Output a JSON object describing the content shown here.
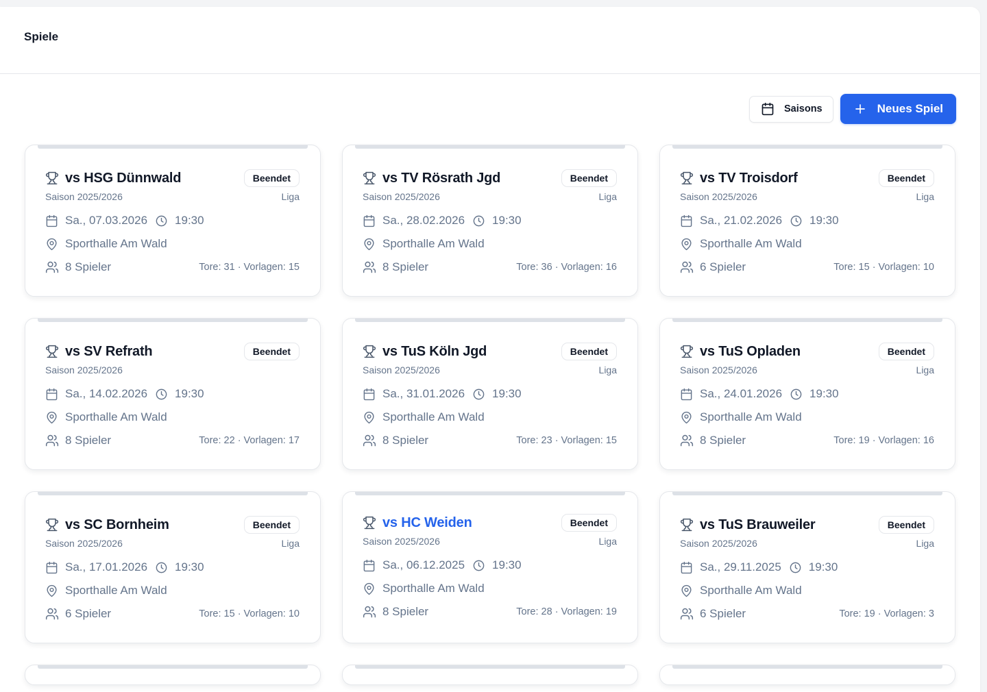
{
  "page": {
    "title": "Spiele"
  },
  "toolbar": {
    "seasons_label": "Saisons",
    "new_game_label": "Neues Spiel"
  },
  "colors": {
    "primary": "#2563eb",
    "muted": "#64748b",
    "text": "#111827"
  },
  "games": [
    {
      "opponent": "vs HSG Dünnwald",
      "status": "Beendet",
      "season": "Saison 2025/2026",
      "type": "Liga",
      "date": "Sa., 07.03.2026",
      "time": "19:30",
      "location": "Sporthalle Am Wald",
      "players": "8 Spieler",
      "stats": "Tore: 31 · Vorlagen: 15"
    },
    {
      "opponent": "vs TV Rösrath Jgd",
      "status": "Beendet",
      "season": "Saison 2025/2026",
      "type": "Liga",
      "date": "Sa., 28.02.2026",
      "time": "19:30",
      "location": "Sporthalle Am Wald",
      "players": "8 Spieler",
      "stats": "Tore: 36 · Vorlagen: 16"
    },
    {
      "opponent": "vs TV Troisdorf",
      "status": "Beendet",
      "season": "Saison 2025/2026",
      "type": "Liga",
      "date": "Sa., 21.02.2026",
      "time": "19:30",
      "location": "Sporthalle Am Wald",
      "players": "6 Spieler",
      "stats": "Tore: 15 · Vorlagen: 10"
    },
    {
      "opponent": "vs SV Refrath",
      "status": "Beendet",
      "season": "Saison 2025/2026",
      "type": "",
      "date": "Sa., 14.02.2026",
      "time": "19:30",
      "location": "Sporthalle Am Wald",
      "players": "8 Spieler",
      "stats": "Tore: 22 · Vorlagen: 17"
    },
    {
      "opponent": "vs TuS Köln Jgd",
      "status": "Beendet",
      "season": "Saison 2025/2026",
      "type": "Liga",
      "date": "Sa., 31.01.2026",
      "time": "19:30",
      "location": "Sporthalle Am Wald",
      "players": "8 Spieler",
      "stats": "Tore: 23 · Vorlagen: 15"
    },
    {
      "opponent": "vs TuS Opladen",
      "status": "Beendet",
      "season": "Saison 2025/2026",
      "type": "Liga",
      "date": "Sa., 24.01.2026",
      "time": "19:30",
      "location": "Sporthalle Am Wald",
      "players": "8 Spieler",
      "stats": "Tore: 19 · Vorlagen: 16"
    },
    {
      "opponent": "vs SC Bornheim",
      "status": "Beendet",
      "season": "Saison 2025/2026",
      "type": "Liga",
      "date": "Sa., 17.01.2026",
      "time": "19:30",
      "location": "Sporthalle Am Wald",
      "players": "6 Spieler",
      "stats": "Tore: 15 · Vorlagen: 10"
    },
    {
      "opponent": "vs HC Weiden",
      "status": "Beendet",
      "season": "Saison 2025/2026",
      "type": "Liga",
      "date": "Sa., 06.12.2025",
      "time": "19:30",
      "location": "Sporthalle Am Wald",
      "players": "8 Spieler",
      "stats": "Tore: 28 · Vorlagen: 19"
    },
    {
      "opponent": "vs TuS Brauweiler",
      "status": "Beendet",
      "season": "Saison 2025/2026",
      "type": "Liga",
      "date": "Sa., 29.11.2025",
      "time": "19:30",
      "location": "Sporthalle Am Wald",
      "players": "6 Spieler",
      "stats": "Tore: 19 · Vorlagen: 3"
    }
  ]
}
